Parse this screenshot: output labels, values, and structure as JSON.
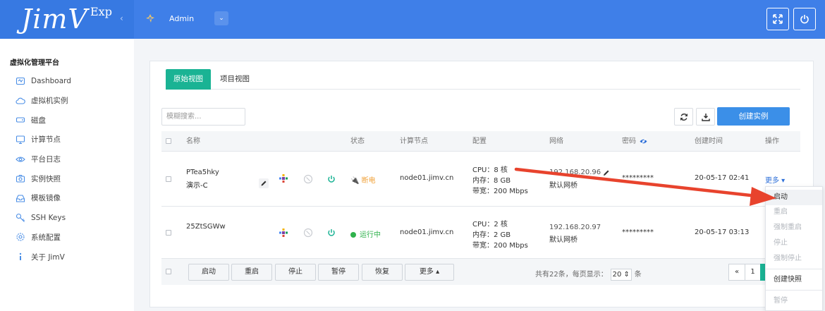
{
  "header": {
    "logo": "JimV",
    "logo_sup": "Exp",
    "collapse_icon": "chevron-left",
    "user_name": "Admin",
    "user_caret": "⌄",
    "fullscreen_icon": "expand-icon",
    "power_icon": "power-icon"
  },
  "sidebar": {
    "title": "虚拟化管理平台",
    "items": [
      {
        "label": "Dashboard",
        "icon": "dashboard-icon"
      },
      {
        "label": "虚拟机实例",
        "icon": "cloud-icon"
      },
      {
        "label": "磁盘",
        "icon": "disk-icon"
      },
      {
        "label": "计算节点",
        "icon": "monitor-icon"
      },
      {
        "label": "平台日志",
        "icon": "eye-icon"
      },
      {
        "label": "实例快照",
        "icon": "camera-icon"
      },
      {
        "label": "模板镜像",
        "icon": "inbox-icon"
      },
      {
        "label": "SSH Keys",
        "icon": "key-icon"
      },
      {
        "label": "系统配置",
        "icon": "gear-icon"
      },
      {
        "label": "关于 JimV",
        "icon": "info-icon"
      }
    ]
  },
  "main": {
    "tabs": [
      {
        "label": "原始视图",
        "active": true
      },
      {
        "label": "项目视图",
        "active": false
      }
    ],
    "search_placeholder": "模糊搜索...",
    "create_label": "创建实例",
    "columns": [
      "名称",
      "状态",
      "计算节点",
      "配置",
      "网络",
      "密码",
      "创建时间",
      "操作"
    ],
    "rows": [
      {
        "name": "PTea5hky",
        "alias": "演示-C",
        "status": "断电",
        "node": "node01.jimv.cn",
        "cpu": "CPU：8 核",
        "mem": "内存：8 GB",
        "bw": "带宽：200 Mbps",
        "ip": "192.168.20.96",
        "net": "默认网桥",
        "password": "*********",
        "created": "20-05-17 02:41",
        "action": "更多 ▾"
      },
      {
        "name": "25ZtSGWw",
        "alias": "",
        "status": "运行中",
        "node": "node01.jimv.cn",
        "cpu": "CPU：2 核",
        "mem": "内存：2 GB",
        "bw": "带宽：200 Mbps",
        "ip": "192.168.20.97",
        "net": "默认网桥",
        "password": "*********",
        "created": "20-05-17 03:13",
        "action": ""
      }
    ],
    "footer_buttons": [
      "启动",
      "重启",
      "停止",
      "暂停",
      "恢复",
      "更多 ▴"
    ],
    "pager": {
      "total_text": "共有22条，每页显示：",
      "page_size": "20 ⇕",
      "unit": "条",
      "prev": "«",
      "page": "1"
    }
  },
  "dropdown": {
    "items": [
      "启动",
      "重启",
      "强制重启",
      "停止",
      "强制停止",
      "创建快照",
      "暂停"
    ]
  },
  "colors": {
    "header": "#3f7fe8",
    "accent_green": "#1ab394",
    "create_blue": "#3b8fe8",
    "arrow_red": "#e8432d"
  }
}
